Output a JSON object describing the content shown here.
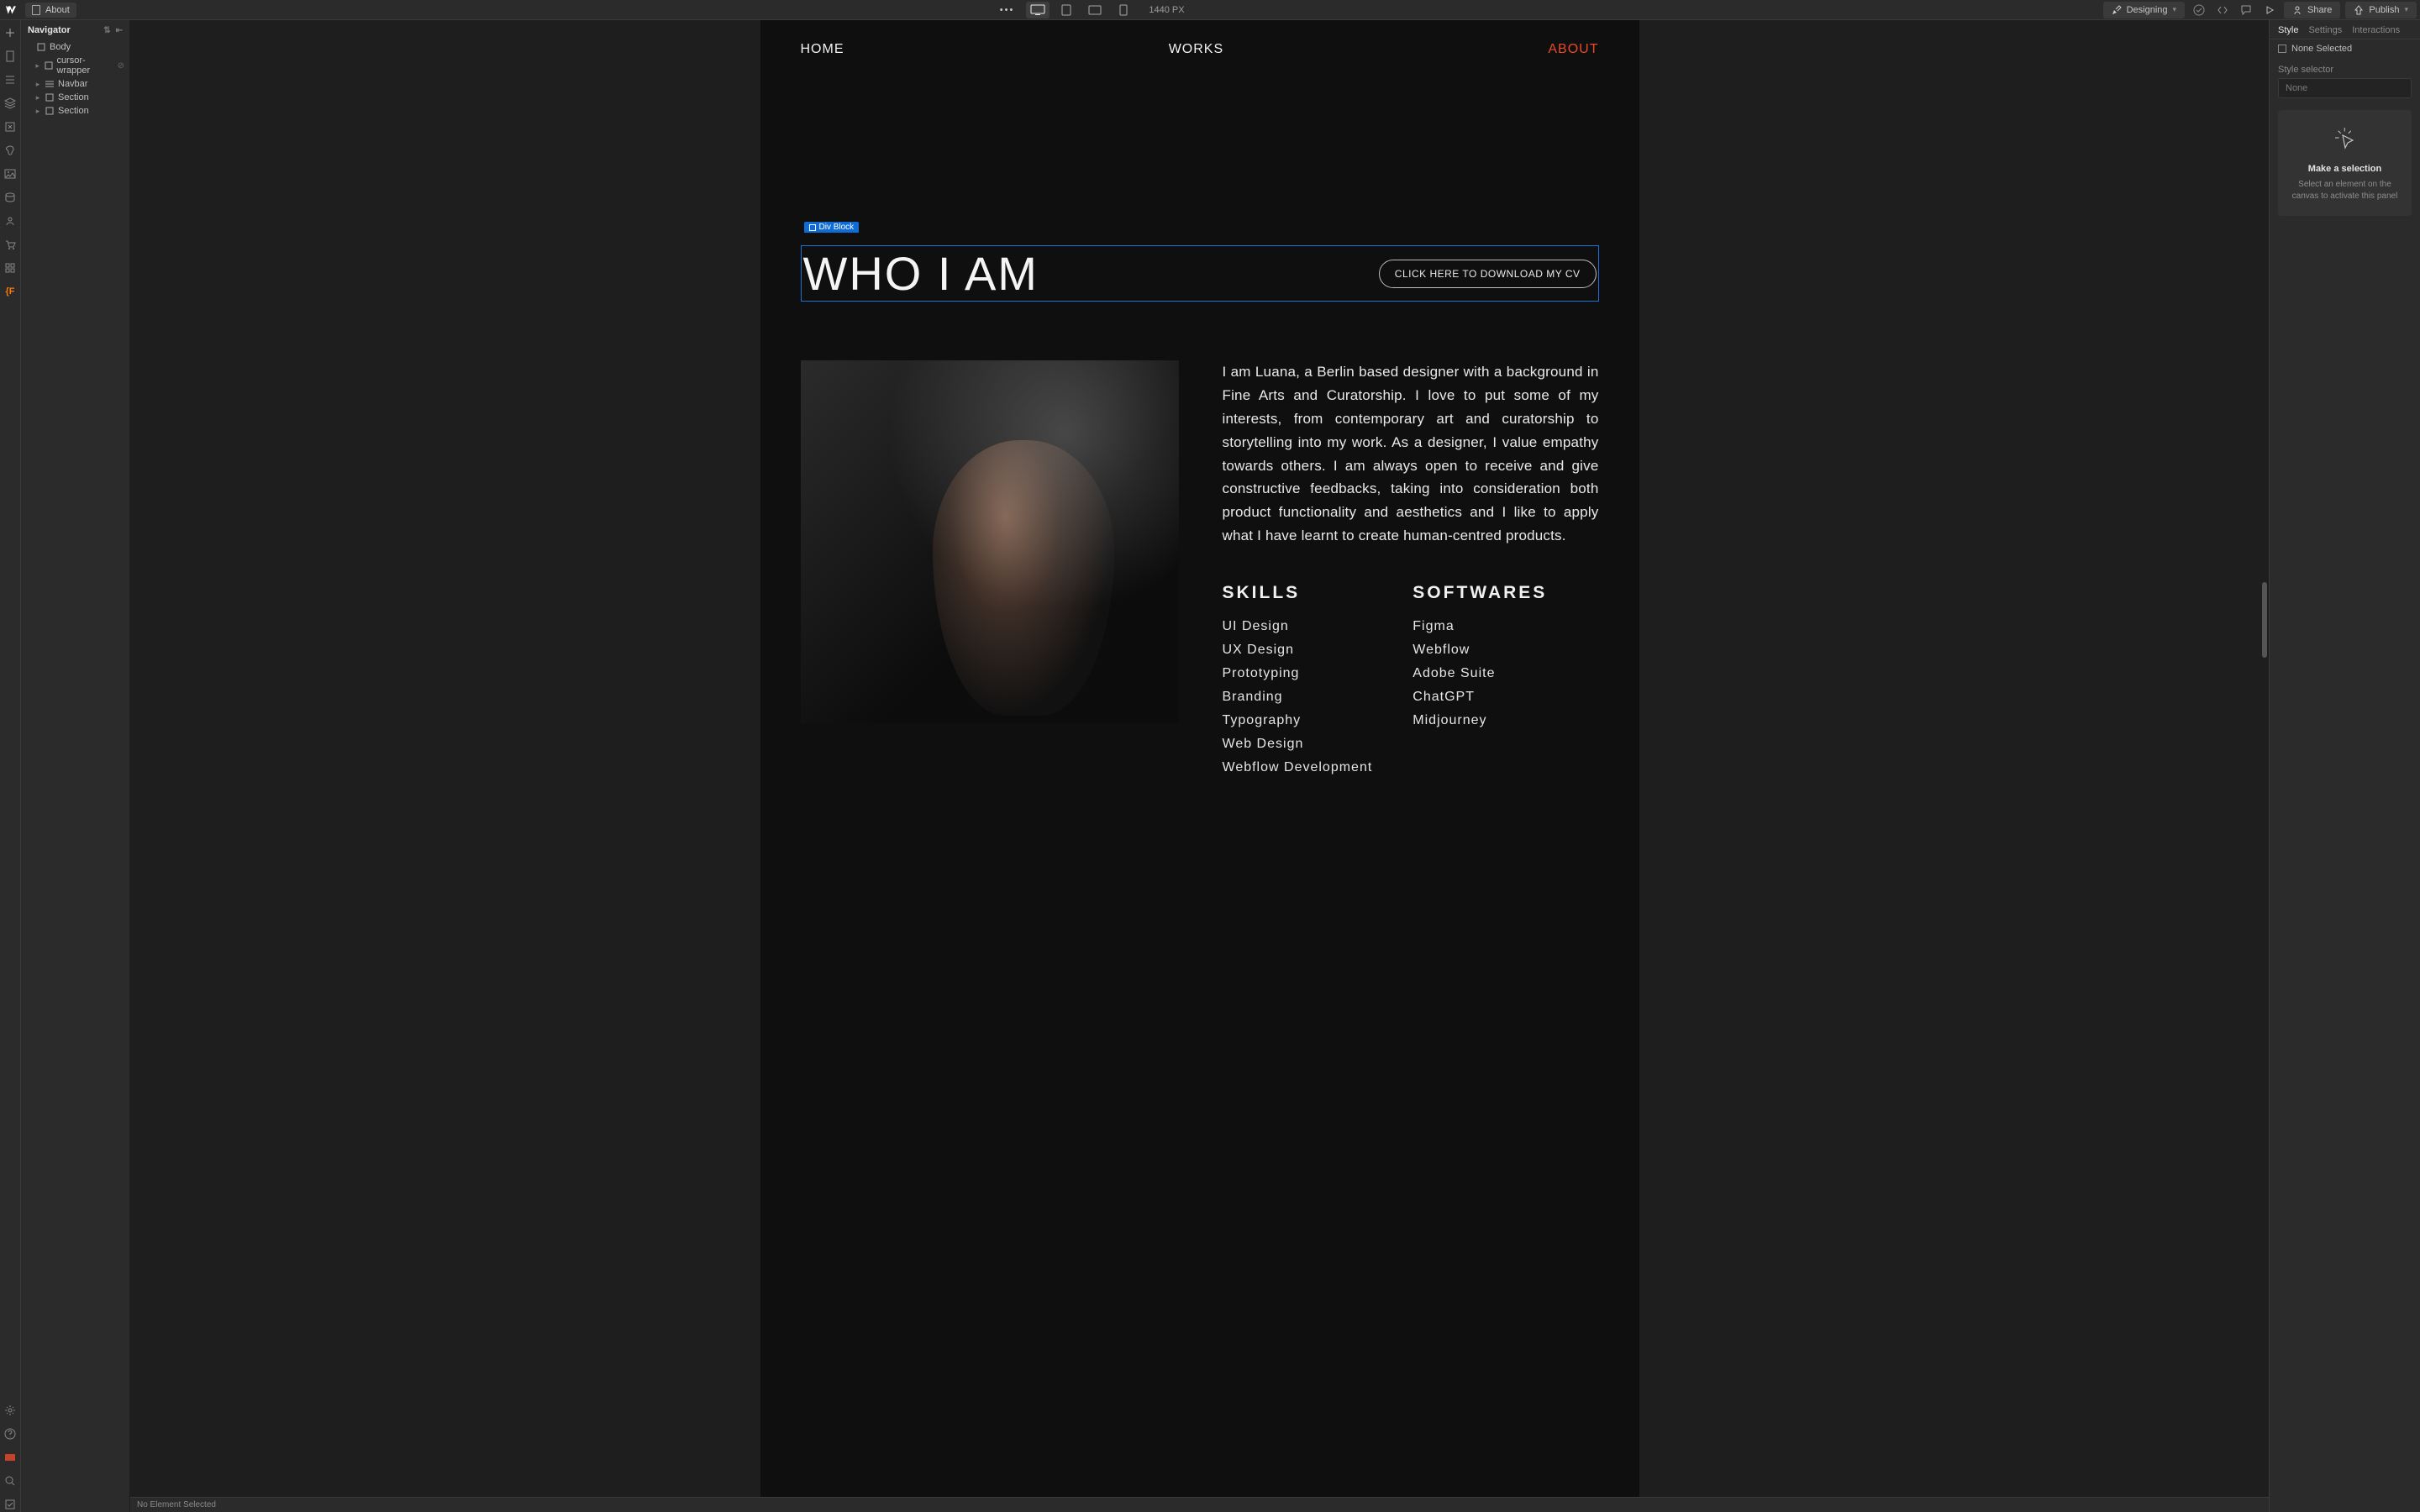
{
  "topbar": {
    "page_name": "About",
    "breakpoint_label": "1440 PX",
    "mode_label": "Designing",
    "share_label": "Share",
    "publish_label": "Publish"
  },
  "navigator": {
    "title": "Navigator",
    "tree": {
      "body": "Body",
      "items": [
        {
          "label": "cursor-wrapper",
          "icon": "arrow"
        },
        {
          "label": "Navbar",
          "icon": "nav"
        },
        {
          "label": "Section",
          "icon": "box"
        },
        {
          "label": "Section",
          "icon": "box"
        }
      ]
    }
  },
  "canvas": {
    "nav": {
      "home": "HOME",
      "works": "WORKS",
      "about": "ABOUT"
    },
    "selected_tag": "Div Block",
    "hero_title": "WHO I AM",
    "cv_button": "CLICK HERE TO DOWNLOAD MY CV",
    "bio": "I am Luana, a Berlin based designer with a background in Fine Arts and Curatorship. I love to put some of my interests, from contemporary art and curatorship to storytelling into my work. As a designer, I value empathy towards others. I am always open to receive and give constructive feedbacks, taking into consideration both product functionality and aesthetics and I like to apply what I have learnt to create human-centred products.",
    "skills_heading": "SKILLS",
    "skills": [
      "UI Design",
      "UX Design",
      "Prototyping",
      "Branding",
      "Typography",
      "Web Design",
      "Webflow Development"
    ],
    "softwares_heading": "SOFTWARES",
    "softwares": [
      "Figma",
      "Webflow",
      "Adobe Suite",
      "ChatGPT",
      "Midjourney"
    ]
  },
  "status_bar": {
    "text": "No Element Selected"
  },
  "right_panel": {
    "tabs": {
      "style": "Style",
      "settings": "Settings",
      "interactions": "Interactions"
    },
    "selection": "None Selected",
    "style_selector_label": "Style selector",
    "style_selector_value": "None",
    "empty_title": "Make a selection",
    "empty_body": "Select an element on the canvas to activate this panel"
  }
}
